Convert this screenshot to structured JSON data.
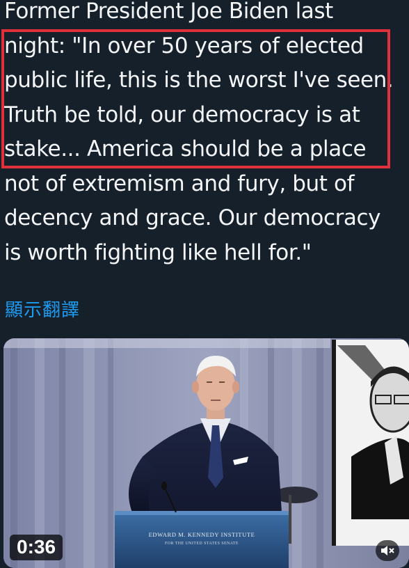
{
  "tweet": {
    "lines": [
      "Former President Joe Biden last",
      "night: \"In over 50 years of elected",
      "public life, this is the worst I've seen.",
      "Truth be told, our democracy is at",
      "stake... America should be a place",
      "not of extremism and fury, but of",
      "decency and grace. Our democracy",
      "is worth fighting like hell for.\""
    ],
    "translate_label": "顯示翻譯",
    "highlight_color": "#e0303c"
  },
  "video": {
    "duration": "0:36",
    "podium_text": "EDWARD M. KENNEDY INSTITUTE",
    "podium_subtext": "FOR THE UNITED STATES SENATE",
    "mute_icon": "speaker-muted-icon"
  },
  "colors": {
    "background": "#15202b",
    "text": "#f3f5f7",
    "link": "#1d9bf0"
  }
}
